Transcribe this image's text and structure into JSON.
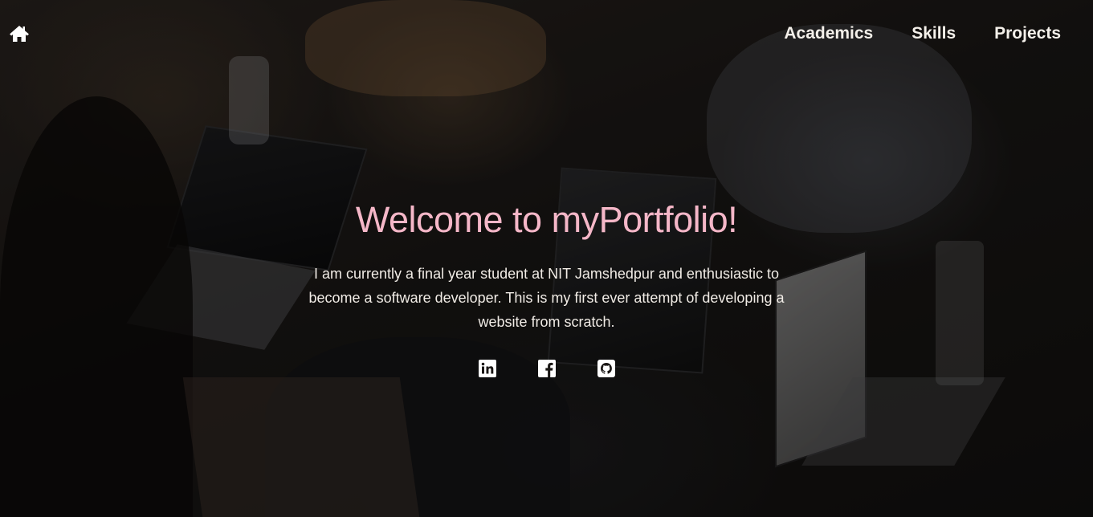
{
  "nav": {
    "home_icon": "home-icon",
    "items": [
      {
        "label": "Academics"
      },
      {
        "label": "Skills"
      },
      {
        "label": "Projects"
      }
    ]
  },
  "hero": {
    "title": "Welcome to myPortfolio!",
    "description": "I am currently a final year student at NIT Jamshedpur and enthusiastic to become a software developer. This is my first ever attempt of developing a website from scratch.",
    "socials": [
      {
        "icon": "linkedin-icon"
      },
      {
        "icon": "facebook-icon"
      },
      {
        "icon": "github-icon"
      }
    ]
  },
  "colors": {
    "title": "#f5b7c8",
    "text": "#f1ece6",
    "overlay": "#171513"
  }
}
